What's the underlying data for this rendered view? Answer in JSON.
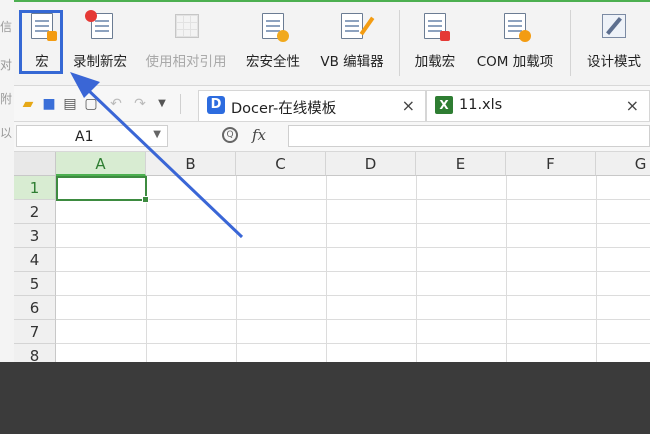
{
  "side_text": [
    "信",
    "对",
    "附",
    "以"
  ],
  "ribbon": {
    "buttons": [
      {
        "label": "宏",
        "icon": "macro-icon"
      },
      {
        "label": "录制新宏",
        "icon": "record-macro-icon"
      },
      {
        "label": "使用相对引用",
        "icon": "relative-reference-icon"
      },
      {
        "label": "宏安全性",
        "icon": "macro-security-icon"
      },
      {
        "label": "VB 编辑器",
        "icon": "vb-editor-icon"
      },
      {
        "label": "加载宏",
        "icon": "addins-icon"
      },
      {
        "label": "COM 加载项",
        "icon": "com-addins-icon"
      },
      {
        "label": "设计模式",
        "icon": "design-mode-icon"
      }
    ]
  },
  "tabs": [
    {
      "label": "Docer-在线模板",
      "close": "×"
    },
    {
      "label": "11.xls",
      "close": "×"
    }
  ],
  "formula_bar": {
    "name_box": "A1",
    "zoom_icon": "Q",
    "fx": "fx",
    "value": ""
  },
  "sheet": {
    "columns": [
      "A",
      "B",
      "C",
      "D",
      "E",
      "F",
      "G"
    ],
    "rows": [
      "1",
      "2",
      "3",
      "4",
      "5",
      "6",
      "7",
      "8"
    ],
    "active_cell": "A1"
  },
  "colors": {
    "accent_green": "#4caf50",
    "highlight_blue": "#3568d4"
  }
}
